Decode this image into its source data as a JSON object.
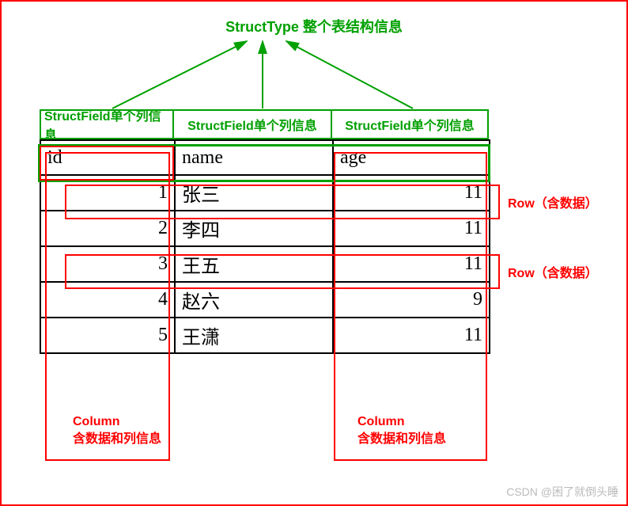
{
  "title": "StructType 整个表结构信息",
  "struct_fields": [
    "StructField单个列信息",
    "StructField单个列信息",
    "StructField单个列信息"
  ],
  "headers": {
    "id": "id",
    "name": "name",
    "age": "age"
  },
  "rows": [
    {
      "id": "1",
      "name": "张三",
      "age": "11"
    },
    {
      "id": "2",
      "name": "李四",
      "age": "11"
    },
    {
      "id": "3",
      "name": "王五",
      "age": "11"
    },
    {
      "id": "4",
      "name": "赵六",
      "age": "9"
    },
    {
      "id": "5",
      "name": "王潇",
      "age": "11"
    }
  ],
  "row_label": "Row（含数据）",
  "column_label_line1": "Column",
  "column_label_line2": "含数据和列信息",
  "watermark": "CSDN @困了就倒头睡",
  "chart_data": {
    "type": "table",
    "title": "StructType 整个表结构信息",
    "columns": [
      "id",
      "name",
      "age"
    ],
    "data": [
      [
        1,
        "张三",
        11
      ],
      [
        2,
        "李四",
        11
      ],
      [
        3,
        "王五",
        11
      ],
      [
        4,
        "赵六",
        9
      ],
      [
        5,
        "王潇",
        11
      ]
    ],
    "annotations": {
      "StructType": "整个表结构信息",
      "StructField": "单个列信息",
      "Row": "含数据",
      "Column": "含数据和列信息"
    }
  }
}
